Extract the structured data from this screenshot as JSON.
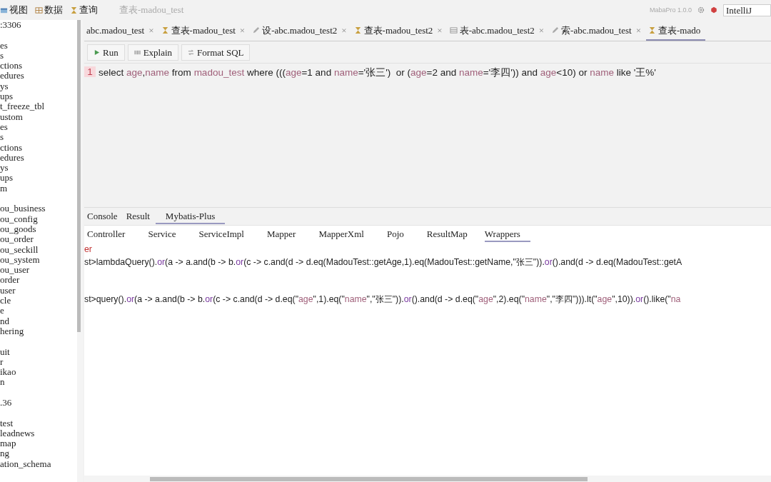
{
  "menu": [
    {
      "label": "视图",
      "kind": "view"
    },
    {
      "label": "数据",
      "kind": "data"
    },
    {
      "label": "查询",
      "kind": "query"
    }
  ],
  "window": {
    "title": "查表-madou_test"
  },
  "top_right": {
    "version": "MabaPro 1.0.0",
    "theme": "IntelliJ"
  },
  "sidebar": {
    "groups": [
      [
        ":3306"
      ],
      [
        "es",
        "s",
        "ctions",
        "edures",
        "ys",
        "ups",
        "t_freeze_tbl",
        "ustom",
        "es",
        "s",
        "ctions",
        "edures",
        "ys",
        "ups",
        "m"
      ],
      [
        "ou_business",
        "ou_config",
        "ou_goods",
        "ou_order",
        "ou_seckill",
        "ou_system",
        "ou_user",
        "order",
        "user",
        "cle",
        "e",
        "nd",
        "hering"
      ],
      [
        "uit",
        "r",
        "ikao",
        "n"
      ],
      [
        ".36"
      ],
      [
        "test",
        "leadnews",
        "map",
        "ng",
        "ation_schema"
      ]
    ]
  },
  "editor_tabs": [
    {
      "label": "abc.madou_test",
      "kind": "plain",
      "close": "×",
      "selected": false
    },
    {
      "label": "查表-madou_test",
      "kind": "query",
      "close": "×",
      "selected": false
    },
    {
      "label": "设-abc.madou_test2",
      "kind": "edit",
      "close": "×",
      "selected": false
    },
    {
      "label": "查表-madou_test2",
      "kind": "query",
      "close": "×",
      "selected": false
    },
    {
      "label": "表-abc.madou_test2",
      "kind": "table",
      "close": "×",
      "selected": false
    },
    {
      "label": "索-abc.madou_test",
      "kind": "edit",
      "close": "×",
      "selected": false
    },
    {
      "label": "查表-mado",
      "kind": "query",
      "selected": true
    }
  ],
  "toolbar": [
    {
      "label": "Run",
      "kind": "run"
    },
    {
      "label": "Explain",
      "kind": "explain"
    },
    {
      "label": "Format SQL",
      "kind": "format"
    }
  ],
  "editor": {
    "line_number": "1",
    "segments": [
      {
        "t": "select ",
        "kind": "text"
      },
      {
        "t": "age",
        "kind": "field"
      },
      {
        "t": ",",
        "kind": "text"
      },
      {
        "t": "name",
        "kind": "field"
      },
      {
        "t": " from ",
        "kind": "text"
      },
      {
        "t": "madou_test",
        "kind": "field"
      },
      {
        "t": " where (((",
        "kind": "text"
      },
      {
        "t": "age",
        "kind": "field"
      },
      {
        "t": "=1 and ",
        "kind": "text"
      },
      {
        "t": "name",
        "kind": "field"
      },
      {
        "t": "='张三')  or (",
        "kind": "text"
      },
      {
        "t": "age",
        "kind": "field"
      },
      {
        "t": "=2 and ",
        "kind": "text"
      },
      {
        "t": "name",
        "kind": "field"
      },
      {
        "t": "='李四')) and ",
        "kind": "text"
      },
      {
        "t": "age",
        "kind": "field"
      },
      {
        "t": "<10) or ",
        "kind": "text"
      },
      {
        "t": "name",
        "kind": "field"
      },
      {
        "t": " like '王%'",
        "kind": "text"
      }
    ]
  },
  "result_tabs": [
    {
      "label": "Console",
      "selected": false
    },
    {
      "label": "Result",
      "selected": false
    },
    {
      "label": "Mybatis-Plus",
      "selected": true
    }
  ],
  "code_tabs": [
    {
      "label": "Controller",
      "selected": false
    },
    {
      "label": "Service",
      "selected": false
    },
    {
      "label": "ServiceImpl",
      "selected": false
    },
    {
      "label": "Mapper",
      "selected": false
    },
    {
      "label": "MapperXml",
      "selected": false
    },
    {
      "label": "Pojo",
      "selected": false
    },
    {
      "label": "ResultMap",
      "selected": false
    },
    {
      "label": "Wrappers",
      "selected": true
    }
  ],
  "code_blocks": [
    [
      [
        {
          "t": "er",
          "kind": "error"
        }
      ],
      [
        {
          "t": "st>lambdaQuery().",
          "kind": "text"
        },
        {
          "t": "or",
          "kind": "method"
        },
        {
          "t": "(a -> a.and(b -> b.",
          "kind": "text"
        },
        {
          "t": "or",
          "kind": "method"
        },
        {
          "t": "(c -> c.and(d -> d.eq(MadouTest::getAge,1).eq(MadouTest::getName,\"张三\")).",
          "kind": "text"
        },
        {
          "t": "or",
          "kind": "method"
        },
        {
          "t": "().and(d -> d.eq(MadouTest::getA",
          "kind": "text"
        }
      ]
    ],
    [
      [
        {
          "t": "st>query().",
          "kind": "text"
        },
        {
          "t": "or",
          "kind": "method"
        },
        {
          "t": "(a -> a.and(b -> b.",
          "kind": "text"
        },
        {
          "t": "or",
          "kind": "method"
        },
        {
          "t": "(c -> c.and(d -> d.eq(\"",
          "kind": "text"
        },
        {
          "t": "age",
          "kind": "field"
        },
        {
          "t": "\",1).eq(\"",
          "kind": "text"
        },
        {
          "t": "name",
          "kind": "field"
        },
        {
          "t": "\",\"张三\")).",
          "kind": "text"
        },
        {
          "t": "or",
          "kind": "method"
        },
        {
          "t": "().and(d -> d.eq(\"",
          "kind": "text"
        },
        {
          "t": "age",
          "kind": "field"
        },
        {
          "t": "\",2).eq(\"",
          "kind": "text"
        },
        {
          "t": "name",
          "kind": "field"
        },
        {
          "t": "\",\"李四\"))).lt(\"",
          "kind": "text"
        },
        {
          "t": "age",
          "kind": "field"
        },
        {
          "t": "\",10)).",
          "kind": "text"
        },
        {
          "t": "or",
          "kind": "method"
        },
        {
          "t": "().like(\"",
          "kind": "text"
        },
        {
          "t": "na",
          "kind": "field"
        }
      ]
    ]
  ]
}
